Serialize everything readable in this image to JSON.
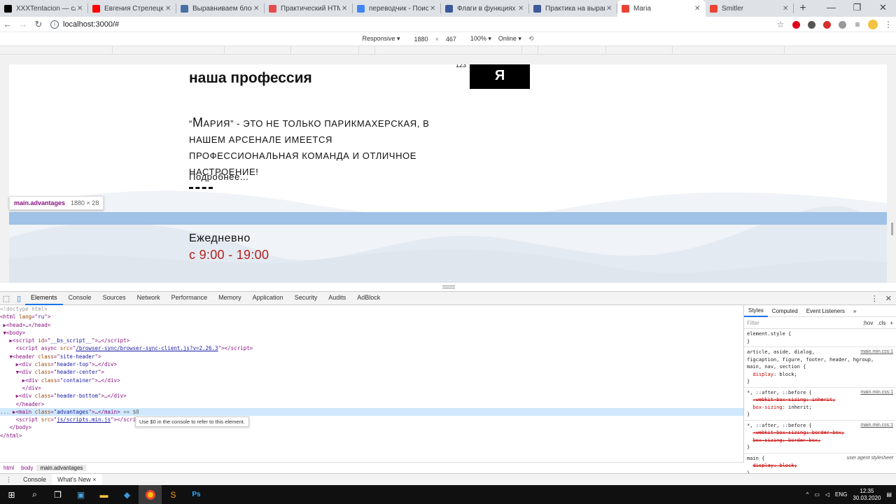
{
  "browser": {
    "tabs": [
      {
        "title": "XXXTentacion — слуша",
        "fav": "#000000"
      },
      {
        "title": "Евгения Стрелецкая -",
        "fav": "#ff0000"
      },
      {
        "title": "Выравниваем блок по",
        "fav": "#4a6fa5"
      },
      {
        "title": "Практический HTML",
        "fav": "#e44d4d"
      },
      {
        "title": "переводчик - Поиск в",
        "fav": "#4285f4"
      },
      {
        "title": "Флаги в функциях Java",
        "fav": "#3c5a99"
      },
      {
        "title": "Практика на выравни",
        "fav": "#3c5a99"
      },
      {
        "title": "Maria",
        "fav": "#ea4335"
      },
      {
        "title": "Smitler",
        "fav": "#ea4335"
      }
    ],
    "active_tab": 7,
    "url": "localhost:3000/#"
  },
  "device_toolbar": {
    "mode": "Responsive ▾",
    "width": "1880",
    "x": "×",
    "height": "467",
    "zoom": "100% ▾",
    "network": "Online ▾"
  },
  "site": {
    "heading": "наша профессия",
    "logo_letter": "Я",
    "logo_number": "123",
    "paragraph_big": "М",
    "paragraph_lead": "“",
    "paragraph_rest": "АРИЯ” - ЭТО НЕ ТОЛЬКО ПАРИКМАХЕРСКАЯ, В НАШЕМ АРСЕНАЛЕ ИМЕЕТСЯ ПРОФЕССИОНАЛЬНАЯ КОМАНДА И ОТЛИЧНОЕ НАСТРОЕНИЕ!",
    "more": "Подробнее...",
    "daily": "Ежедневно",
    "hours": "с 9:00 - 19:00",
    "tooltip_selector": "main.advantages",
    "tooltip_size": "1880 × 28"
  },
  "devtools": {
    "tabs": [
      "Elements",
      "Console",
      "Sources",
      "Network",
      "Performance",
      "Memory",
      "Application",
      "Security",
      "Audits",
      "AdBlock"
    ],
    "active": "Elements",
    "dom": [
      {
        "html": "<span class='d'>&lt;!doctype html&gt;</span>"
      },
      {
        "html": "&lt;html <span class='a'>lang</span>=\"<span class='v'>ru</span>\"&gt;"
      },
      {
        "html": " ▶&lt;head&gt;…&lt;/head&gt;"
      },
      {
        "html": " ▼&lt;body&gt;"
      },
      {
        "html": "   ▶&lt;script <span class='a'>id</span>=\"<span class='v'>__bs_script__</span>\"&gt;…&lt;/script&gt;"
      },
      {
        "html": "     &lt;script async <span class='a'>src</span>=\"<span class='u'>/browser-sync/browser-sync-client.js?v=2.26.3</span>\"&gt;&lt;/script&gt;"
      },
      {
        "html": "   ▼&lt;header <span class='a'>class</span>=\"<span class='v'>site-header</span>\"&gt;"
      },
      {
        "html": "     ▶&lt;div <span class='a'>class</span>=\"<span class='v'>header-top</span>\"&gt;…&lt;/div&gt;"
      },
      {
        "html": "     ▼&lt;div <span class='a'>class</span>=\"<span class='v'>header-center</span>\"&gt;"
      },
      {
        "html": "       ▶&lt;div <span class='a'>class</span>=\"<span class='v'>container</span>\"&gt;…&lt;/div&gt;"
      },
      {
        "html": "       &lt;/div&gt;"
      },
      {
        "html": "     ▶&lt;div <span class='a'>class</span>=\"<span class='v'>header-bottom</span>\"&gt;…&lt;/div&gt;"
      },
      {
        "html": "     &lt;/header&gt;"
      },
      {
        "html": "<span class='g'>...</span> ▶&lt;main <span class='a'>class</span>=\"<span class='v'>advantages</span>\"&gt;…&lt;/main&gt; <span class='g'>== $0</span>",
        "sel": true
      },
      {
        "html": "     &lt;script <span class='a'>src</span>=\"<span class='u'>js/scripts.min.js</span>\"&gt;&lt;/scri"
      },
      {
        "html": "   &lt;/body&gt;"
      },
      {
        "html": "&lt;/html&gt;"
      }
    ],
    "console_hint": "Use $0 in the console to refer to this element.",
    "breadcrumbs": [
      "html",
      "body",
      "main.advantages"
    ],
    "drawer_tabs": [
      "Console",
      "What's New ×"
    ],
    "styles_tabs": [
      "Styles",
      "Computed",
      "Event Listeners",
      "»"
    ],
    "filter_placeholder": "Filter",
    "filter_tools": [
      ":hov",
      ".cls",
      "+"
    ],
    "rules": [
      {
        "html": "element.style {<br>}"
      },
      {
        "html": "<span class='src'>main.min.css:1</span>article, aside, dialog,<br>figcaption, figure, footer, header, hgroup,<br>main, nav, section {<br>&nbsp;&nbsp;<span class='p'>display</span>: block;<br>}"
      },
      {
        "html": "<span class='src'>main.min.css:1</span>*, ::after, ::before {<br>&nbsp;&nbsp;<span class='s'>-webkit-box-sizing: inherit;</span><br>&nbsp;&nbsp;<span class='p'>box-sizing</span>: inherit;<br>}"
      },
      {
        "html": "<span class='src'>main.min.css:1</span>*, ::after, ::before {<br>&nbsp;&nbsp;<span class='s'>-webkit-box-sizing: border-box;</span><br>&nbsp;&nbsp;<span class='s'>box-sizing: border-box;</span><br>}"
      },
      {
        "html": "<span class='src ua'>user agent stylesheet</span>main {<br>&nbsp;&nbsp;<span class='s'>display: block;</span><br>}"
      }
    ]
  },
  "taskbar": {
    "lang": "ENG",
    "time": "12:35",
    "date": "30.03.2020"
  }
}
